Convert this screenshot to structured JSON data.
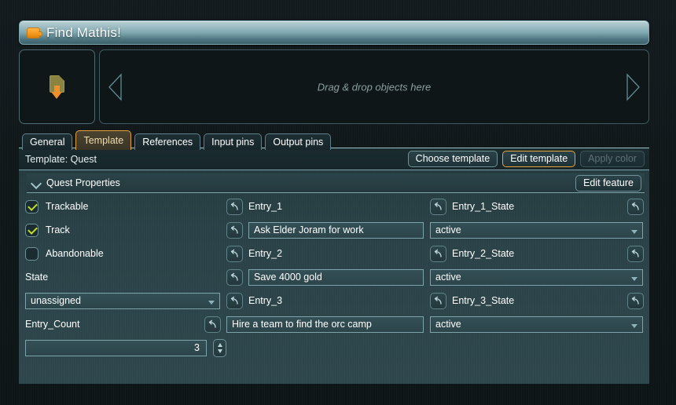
{
  "window": {
    "title": "Find Mathis!",
    "icon": "orange-node-icon"
  },
  "dropzone": {
    "slot_icon": "document-download-icon",
    "hint": "Drag & drop objects here",
    "left_arrow_icon": "triangle-left-icon",
    "right_arrow_icon": "triangle-right-icon"
  },
  "tabs": [
    {
      "label": "General",
      "active": false
    },
    {
      "label": "Template",
      "active": true
    },
    {
      "label": "References",
      "active": false
    },
    {
      "label": "Input pins",
      "active": false
    },
    {
      "label": "Output pins",
      "active": false
    }
  ],
  "toolbar": {
    "template_label": "Template: Quest",
    "choose_template": "Choose template",
    "edit_template": "Edit template",
    "apply_color": "Apply color"
  },
  "feature": {
    "title": "Quest Properties",
    "edit_feature": "Edit feature",
    "collapse_icon": "chevron-down-icon"
  },
  "icons": {
    "revert": "revert-arrow-icon",
    "checkbox": "checkbox-icon",
    "dropdown": "chevron-down-icon",
    "stepper": "spinner-updown-icon"
  },
  "properties": {
    "trackable": {
      "label": "Trackable",
      "checked": true
    },
    "track": {
      "label": "Track",
      "checked": true
    },
    "abandonable": {
      "label": "Abandonable",
      "checked": false
    },
    "state": {
      "label": "State",
      "value": "unassigned"
    },
    "entry_count": {
      "label": "Entry_Count",
      "value": "3"
    }
  },
  "entries": [
    {
      "name_label": "Entry_1",
      "text_value": "Ask Elder Joram for work",
      "state_label": "Entry_1_State",
      "state_value": "active"
    },
    {
      "name_label": "Entry_2",
      "text_value": "Save 4000 gold",
      "state_label": "Entry_2_State",
      "state_value": "active"
    },
    {
      "name_label": "Entry_3",
      "text_value": "Hire a team to find the orc camp",
      "state_label": "Entry_3_State",
      "state_value": "active"
    }
  ],
  "colors": {
    "accent": "#e8a23c",
    "panel": "#2a4247",
    "titlebar_light": "#b9cfd4",
    "check": "#c3dc2a",
    "border": "#7fa3aa"
  }
}
